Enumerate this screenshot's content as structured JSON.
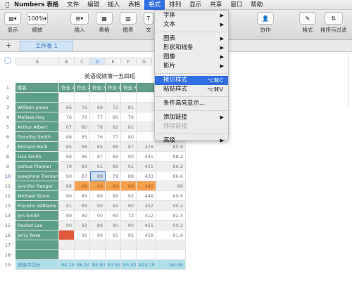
{
  "menubar": {
    "app": "Numbers 表格",
    "items": [
      "文件",
      "编辑",
      "插入",
      "表格",
      "格式",
      "排列",
      "显示",
      "共享",
      "窗口",
      "帮助"
    ],
    "active": "格式"
  },
  "toolbar": {
    "display": "显示",
    "zoom_value": "100%",
    "zoom": "缩放",
    "insert": "插入",
    "table": "表格",
    "chart": "图表",
    "text": "文",
    "collaborate": "协作",
    "format": "格式",
    "sort_filter": "排序与过滤",
    "doc_title": "演"
  },
  "tabs": {
    "add": "+",
    "sheet1": "工作表 1"
  },
  "sheet": {
    "title": "英语成绩簿一五四班",
    "columns": [
      "A",
      "B",
      "C",
      "D",
      "E",
      "F",
      "G"
    ],
    "headers": [
      "姓名",
      "作业 1",
      "作业 2",
      "作业 3",
      "作业 4",
      "作业 5",
      "",
      ""
    ],
    "rows": [
      [
        "",
        "",
        "",
        "",
        "",
        "",
        "",
        ""
      ],
      [
        "William Jones",
        "66",
        "76",
        "69",
        "72",
        "81",
        "",
        ""
      ],
      [
        "Melissa Hay",
        "76",
        "78",
        "77",
        "80",
        "79",
        "",
        ""
      ],
      [
        "Arthur Albert",
        "67",
        "80",
        "78",
        "82",
        "81",
        "",
        ""
      ],
      [
        "Dorothy Smith",
        "88",
        "85",
        "76",
        "77",
        "80",
        "",
        ""
      ],
      [
        "Richard Rock",
        "85",
        "86",
        "84",
        "86",
        "87",
        "428",
        "85.6"
      ],
      [
        "Lisa Smith",
        "89",
        "86",
        "87",
        "89",
        "90",
        "441",
        "88.2"
      ],
      [
        "Joshua Planner",
        "78",
        "89",
        "91",
        "86",
        "91",
        "431",
        "86.2"
      ],
      [
        "Josephine Trenton",
        "90",
        "87",
        "89",
        "79",
        "88",
        "433",
        "86.6"
      ],
      [
        "Jennifer Ranger",
        "88",
        "89",
        "90",
        "89",
        "89",
        "445",
        "89"
      ],
      [
        "Michael Stone",
        "90",
        "89",
        "89",
        "88",
        "92",
        "448",
        "89.6"
      ],
      [
        "Franklin Williams",
        "91",
        "89",
        "90",
        "92",
        "90",
        "452",
        "90.4"
      ],
      [
        "Jon Smith",
        "89",
        "89",
        "90",
        "69",
        "72",
        "412",
        "82.4"
      ],
      [
        "Rachel Lee",
        "90",
        "92",
        "89",
        "90",
        "90",
        "451",
        "90.2"
      ],
      [
        "Jerry Rose",
        "",
        "92",
        "90",
        "91",
        "92",
        "458",
        "91.6"
      ],
      [
        "",
        "",
        "",
        "",
        "",
        "",
        "",
        ""
      ],
      [
        "",
        "",
        "",
        "",
        "",
        "",
        "",
        ""
      ]
    ],
    "footer": [
      "班级平均分",
      "84.29",
      "86.14",
      "84.93",
      "83.93",
      "85.50",
      "424.79",
      "84.96"
    ],
    "row_numbers": [
      "1",
      "2",
      "3",
      "4",
      "5",
      "6",
      "7",
      "8",
      "9",
      "10",
      "11",
      "12",
      "13",
      "14",
      "15",
      "16",
      "17",
      "18",
      "19"
    ]
  },
  "format_menu": {
    "items": [
      {
        "label": "字体",
        "arrow": "▶"
      },
      {
        "label": "文本",
        "arrow": "▶"
      },
      {
        "sep": true
      },
      {
        "label": "图表",
        "arrow": "▶"
      },
      {
        "label": "形状和线条",
        "arrow": "▶"
      },
      {
        "label": "图像",
        "arrow": "▶"
      },
      {
        "label": "影片",
        "arrow": "▶"
      },
      {
        "sep": true
      },
      {
        "label": "拷贝样式",
        "shortcut": "⌥⌘C",
        "highlight": true
      },
      {
        "label": "粘贴样式",
        "shortcut": "⌥⌘V"
      },
      {
        "sep": true
      },
      {
        "label": "条件高亮显示..."
      },
      {
        "sep": true
      },
      {
        "label": "添加链接",
        "arrow": "▶"
      },
      {
        "label": "移除链接",
        "disabled": true
      },
      {
        "sep": true
      },
      {
        "label": "高级",
        "arrow": "▶"
      }
    ]
  },
  "colors": {
    "menu_highlight": "#2f6fe0",
    "header_green": "#5e9f8a",
    "footer_blue": "#aee0ec",
    "orange": "#f6a04d",
    "red": "#e2583a"
  }
}
